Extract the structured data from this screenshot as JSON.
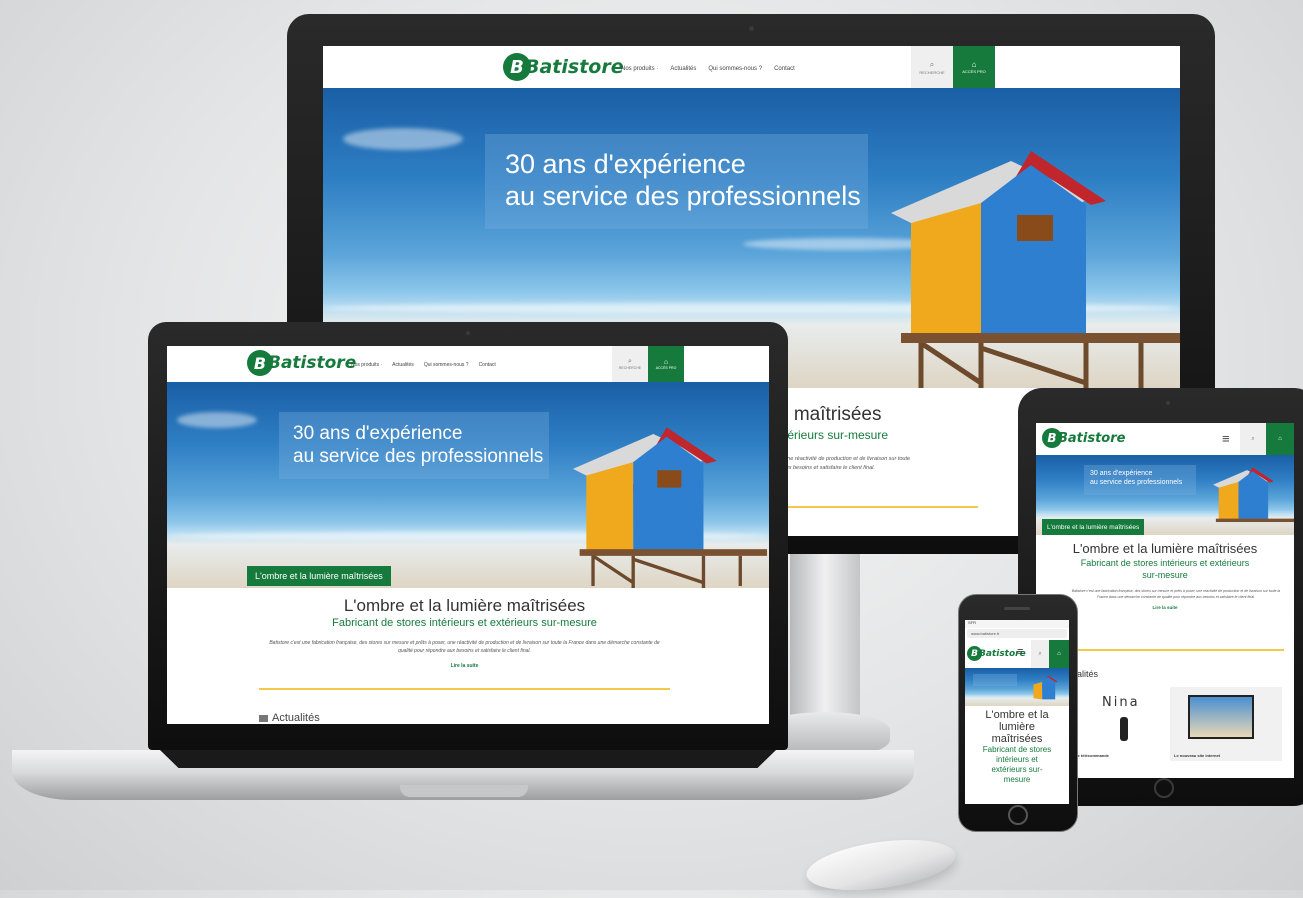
{
  "site": {
    "logo_text": "Batistore",
    "menu": [
      "Nos produits ·",
      "Actualités",
      "Qui sommes-nous ?",
      "Contact"
    ],
    "search_label": "RECHERCHE",
    "access_label": "ACCÈS PRO",
    "hero_line1": "30 ans d'expérience",
    "hero_line2": "au service des professionnels",
    "tag": "L'ombre et la lumière maîtrisées",
    "headline": "L'ombre et la lumière maîtrisées",
    "subheadline": "Fabricant de stores intérieurs et extérieurs sur-mesure",
    "intro": "Batistore c'est une fabrication française, des stores sur mesure et prêts à poser, une réactivité de production et de livraison sur toute la France dans une démarche constante de qualité pour répondre aux besoins et satisfaire le client final.",
    "read_more": "Lire la suite",
    "news_title": "Actualités",
    "news_items": [
      "...lle télécommande",
      "Le nouveau site internet"
    ],
    "nina_brand": "Nina"
  },
  "desktop": {
    "headline_partial": "e maîtrisées",
    "sub_partial": "xtérieurs sur-mesure",
    "intro_partial1": "e, une réactivité de production et de livraison sur toute",
    "intro_partial2": "e aux besoins et satisfaire le client final."
  },
  "tablet": {
    "sub_line1": "Fabricant de stores intérieurs et extérieurs",
    "sub_line2": "sur-mesure",
    "news_partial": "ualités"
  },
  "phone": {
    "url": "www.batistore.fr",
    "status": "SFR",
    "h1_lines": [
      "L'ombre et la",
      "lumière",
      "maîtrisées"
    ],
    "sub_lines": [
      "Fabricant de stores",
      "intérieurs et",
      "extérieurs sur-",
      "mesure"
    ]
  },
  "colors": {
    "brand_green": "#157a3c",
    "accent_yellow": "#f2c94c",
    "sky_blue": "#2e7ec4"
  }
}
